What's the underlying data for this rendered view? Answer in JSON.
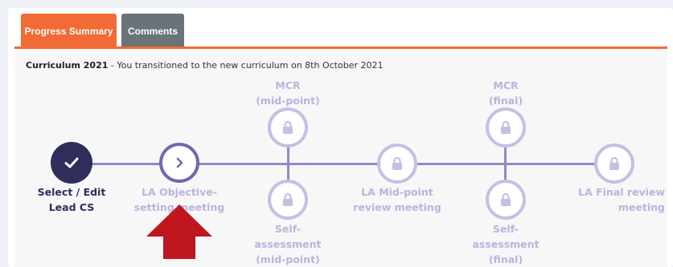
{
  "tabs": {
    "progress_summary": "Progress Summary",
    "comments": "Comments"
  },
  "curriculum": {
    "name": "Curriculum 2021",
    "note": " - You transitioned to the new curriculum on 8th October 2021"
  },
  "timeline": {
    "select_edit": {
      "line1": "Select / Edit",
      "line2": "Lead CS"
    },
    "la_objective": {
      "line1": "LA Objective-",
      "line2": "setting meeting"
    },
    "mcr_mid": {
      "line1": "MCR",
      "line2": "(mid-point)"
    },
    "self_mid": {
      "line1": "Self-",
      "line2": "assessment",
      "line3": "(mid-point)"
    },
    "la_mid": {
      "line1": "LA Mid-point",
      "line2": "review meeting"
    },
    "mcr_final": {
      "line1": "MCR",
      "line2": "(final)"
    },
    "self_final": {
      "line1": "Self-",
      "line2": "assessment",
      "line3": "(final)"
    },
    "la_final": {
      "line1": "LA Final review",
      "line2": "meeting"
    }
  },
  "colors": {
    "accent": "#f26a35",
    "done": "#2e2d5b",
    "current": "#6e69b2",
    "locked": "#c4c0e3",
    "arrow": "#c0161f"
  },
  "icons": [
    "check-icon",
    "chevron-right-icon",
    "lock-icon",
    "arrow-up-icon"
  ]
}
